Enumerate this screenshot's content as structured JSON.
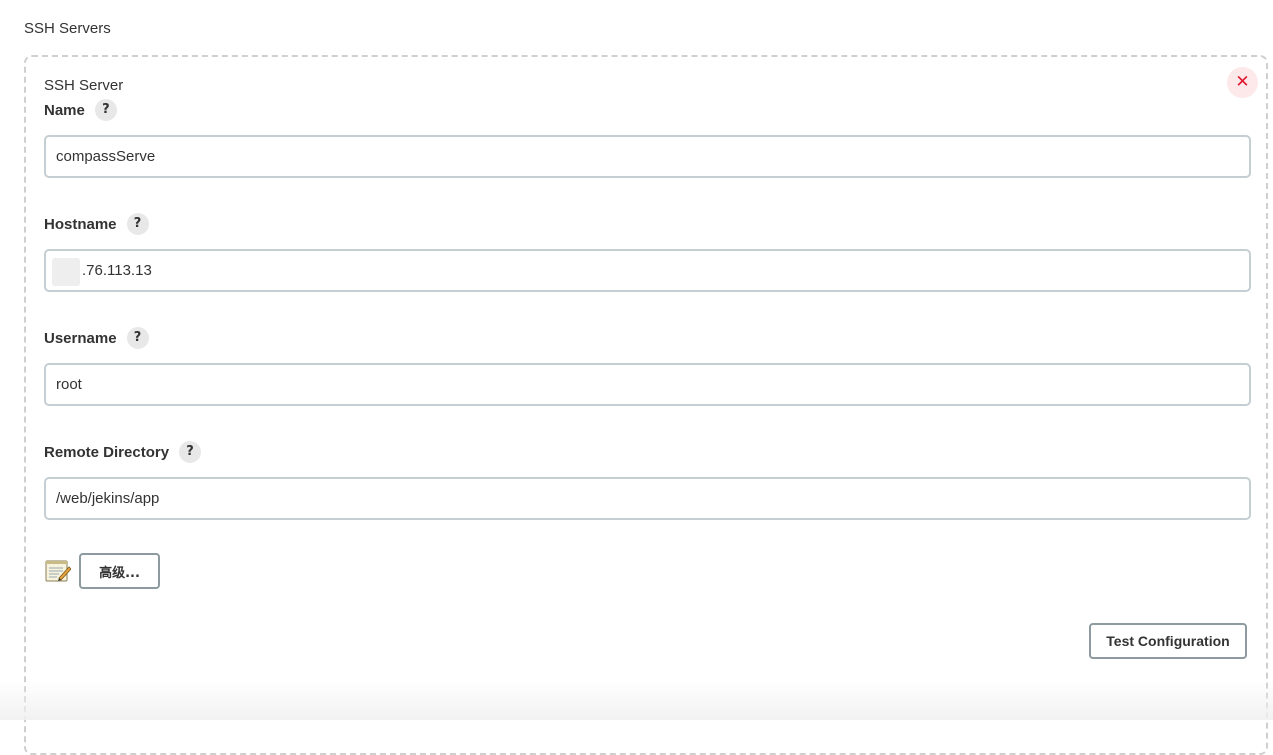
{
  "section": {
    "title": "SSH Servers"
  },
  "server": {
    "header": "SSH Server",
    "delete_symbol": "✕",
    "fields": {
      "name": {
        "label": "Name",
        "help": "?",
        "value": "compassServe"
      },
      "hostname": {
        "label": "Hostname",
        "help": "?",
        "value": ".76.113.13"
      },
      "username": {
        "label": "Username",
        "help": "?",
        "value": "root"
      },
      "remote_directory": {
        "label": "Remote Directory",
        "help": "?",
        "value": "/web/jekins/app"
      }
    },
    "advanced_label": "高级...",
    "test_label": "Test Configuration"
  },
  "colors": {
    "delete_bg": "#fde8ea",
    "delete_fg": "#e0172f",
    "input_border": "#c5cfd3",
    "button_border": "#8d9aa0"
  },
  "icons": {
    "delete": "close-icon",
    "help": "help-icon",
    "notepad": "notepad-icon"
  }
}
